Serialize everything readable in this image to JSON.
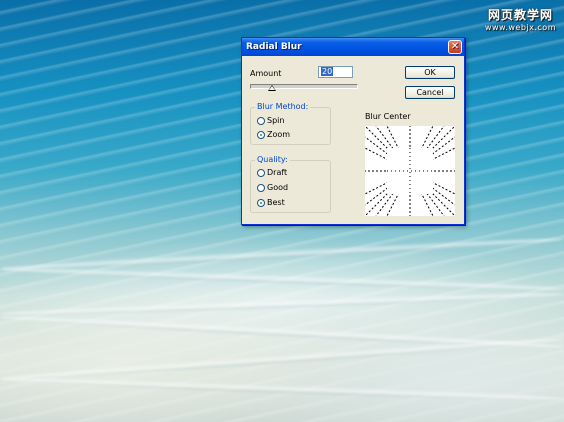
{
  "watermark": {
    "line1": "网页教学网",
    "line2": "www.webjx.com"
  },
  "dialog": {
    "title": "Radial Blur",
    "amount_label": "Amount",
    "amount_value": "20",
    "amount_slider_fraction": 0.2,
    "ok_label": "OK",
    "cancel_label": "Cancel",
    "blur_method": {
      "title": "Blur Method:",
      "options": [
        {
          "label": "Spin",
          "checked": false
        },
        {
          "label": "Zoom",
          "checked": true
        }
      ]
    },
    "quality": {
      "title": "Quality:",
      "options": [
        {
          "label": "Draft",
          "checked": false
        },
        {
          "label": "Good",
          "checked": false
        },
        {
          "label": "Best",
          "checked": true
        }
      ]
    },
    "blur_center_label": "Blur Center"
  }
}
